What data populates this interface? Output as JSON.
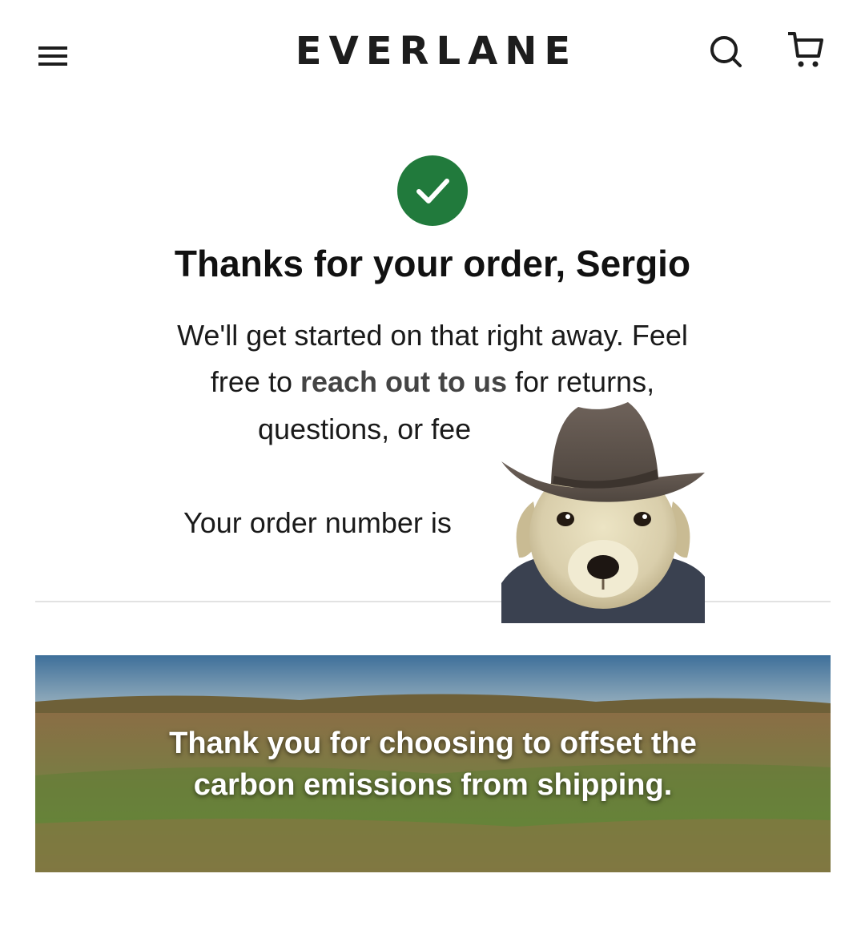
{
  "brand": {
    "logo_text": "EVERLANE"
  },
  "header": {
    "menu_icon": "hamburger-menu-icon",
    "search_icon": "search-icon",
    "cart_icon": "shopping-cart-icon"
  },
  "confirmation": {
    "status_icon": "checkmark-circle-icon",
    "status_color": "#217a3c",
    "title": "Thanks for your order, Sergio",
    "message_line1": "We'll get started on that right away. Feel",
    "message_line2_before": "free to ",
    "message_link": "reach out to us",
    "message_line2_after": " for returns,",
    "message_line3": "questions, or fee",
    "order_number_label": "Your order number is"
  },
  "sticker": {
    "description_icon": "cowboy-dog-sticker"
  },
  "banner": {
    "line1": "Thank you for choosing to offset the",
    "line2": "carbon emissions from shipping."
  }
}
